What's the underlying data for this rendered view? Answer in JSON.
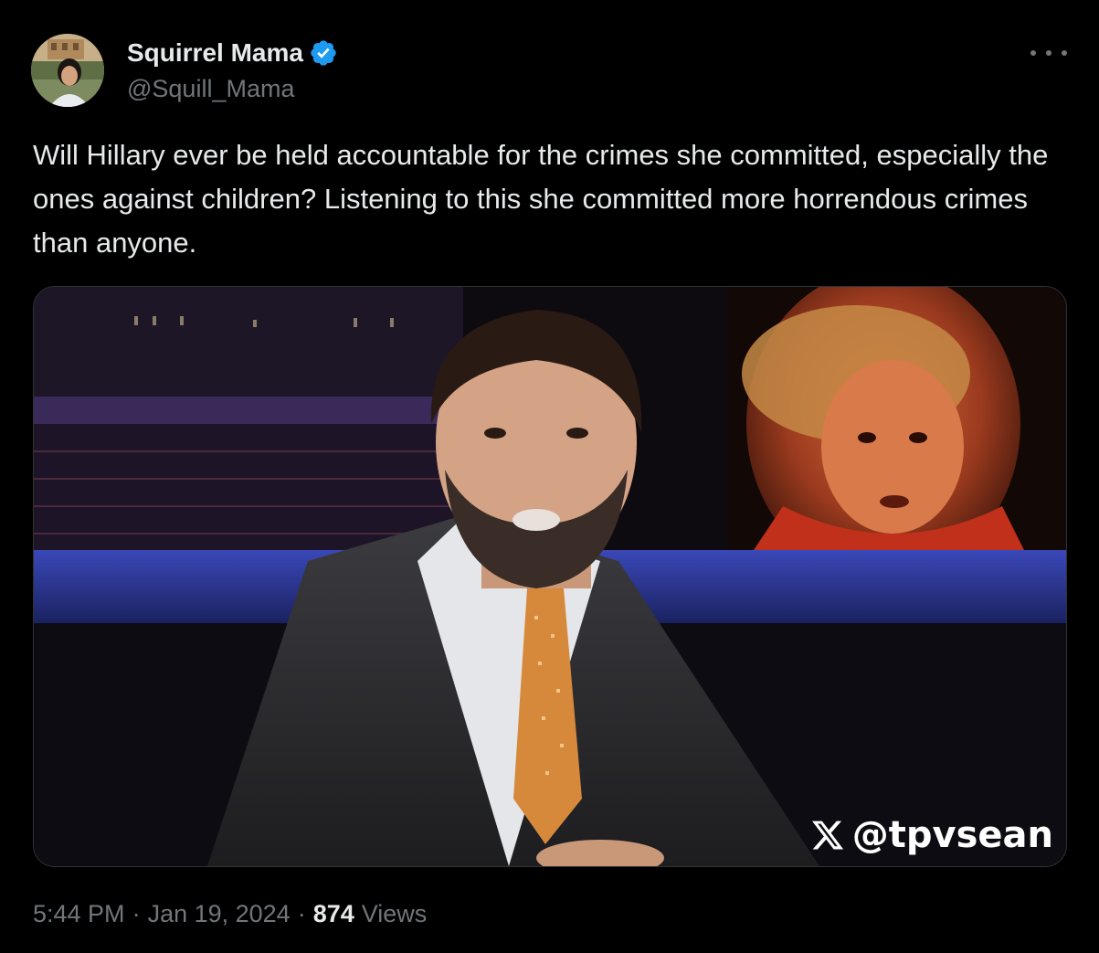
{
  "author": {
    "display_name": "Squirrel Mama",
    "handle": "@Squill_Mama",
    "verified_color": "#1d9bf0"
  },
  "tweet": {
    "text": "Will Hillary ever be held accountable for the crimes she committed, especially the ones against children? Listening to this she committed more horrendous crimes than anyone."
  },
  "media": {
    "watermark_handle": "@tpvsean",
    "watermark_icon": "x-logo-icon"
  },
  "meta": {
    "time": "5:44 PM",
    "separator": "·",
    "date": "Jan 19, 2024",
    "views_count": "874",
    "views_label": "Views"
  },
  "icons": {
    "more": "more-options-icon",
    "verified": "verified-badge-icon"
  },
  "colors": {
    "background": "#000000",
    "text_primary": "#e7e9ea",
    "text_secondary": "#71767b",
    "border": "#2f3336"
  }
}
